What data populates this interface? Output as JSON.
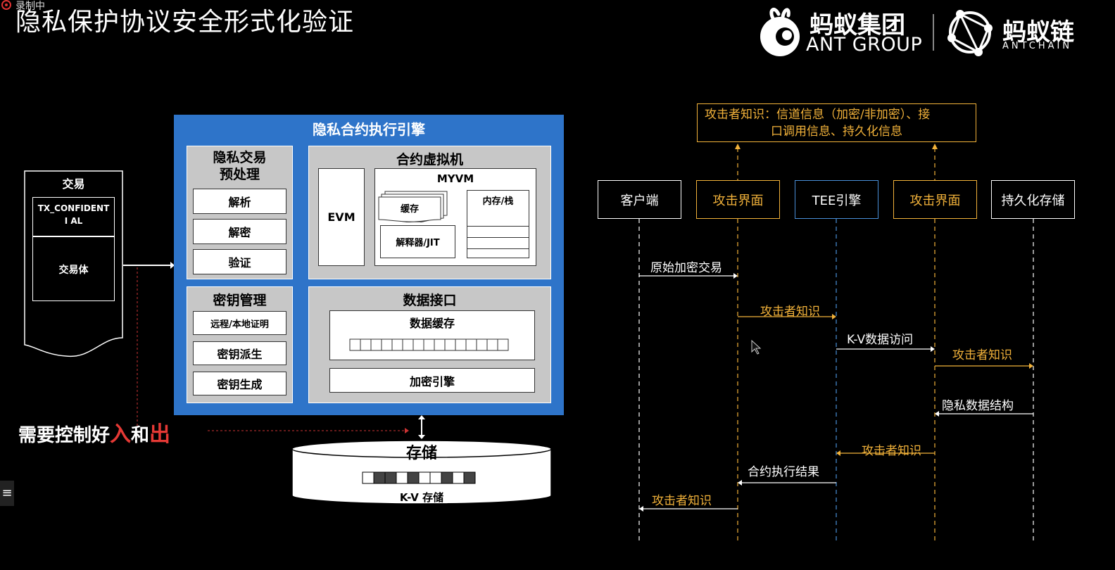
{
  "recording": {
    "label": "录制中"
  },
  "slide_title": "隐私保护协议安全形式化验证",
  "logos": {
    "ant_group_cn": "蚂蚁集团",
    "ant_group_en": "ANT GROUP",
    "antchain_cn": "蚂蚁链",
    "antchain_en": "ANTCHAIN"
  },
  "transaction": {
    "title": "交易",
    "field_label": "TX_CONFIDENTI AL",
    "body_label": "交易体"
  },
  "engine": {
    "title": "隐私合约执行引擎",
    "preprocess": {
      "title": "隐私交易预处理",
      "title_line1": "隐私交易",
      "title_line2": "预处理",
      "items": [
        "解析",
        "解密",
        "验证"
      ]
    },
    "vm": {
      "title": "合约虚拟机",
      "evm": "EVM",
      "myvm": "MYVM",
      "cache": "缓存",
      "interpreter": "解释器/JIT",
      "memory": "内存/栈"
    },
    "keys": {
      "title": "密钥管理",
      "items": [
        "远程/本地证明",
        "密钥派生",
        "密钥生成"
      ]
    },
    "data_interface": {
      "title": "数据接口",
      "cache": "数据缓存",
      "crypto": "加密引擎"
    }
  },
  "control_note": {
    "prefix": "需要控制好",
    "in": "入",
    "and": "和",
    "out": "出"
  },
  "storage": {
    "title": "存储",
    "label": "K-V 存储"
  },
  "sequence": {
    "attacker_knowledge_box": "攻击者知识：信道信息（加密/非加密）、接口调用信息、持久化信息",
    "attacker_knowledge_line1": "攻击者知识：信道信息（加密/非加密）、接",
    "attacker_knowledge_line2": "口调用信息、持久化信息",
    "actors": [
      "客户端",
      "攻击界面",
      "TEE引擎",
      "攻击界面",
      "持久化存储"
    ],
    "messages": [
      "原始加密交易",
      "攻击者知识",
      "K-V数据访问",
      "攻击者知识",
      "隐私数据结构",
      "攻击者知识",
      "合约执行结果",
      "攻击者知识"
    ]
  },
  "colors": {
    "engine_blue": "#2e74c9",
    "orange": "#f2b23a",
    "red": "#e53935",
    "lifeline_blue": "#4a90d9"
  }
}
